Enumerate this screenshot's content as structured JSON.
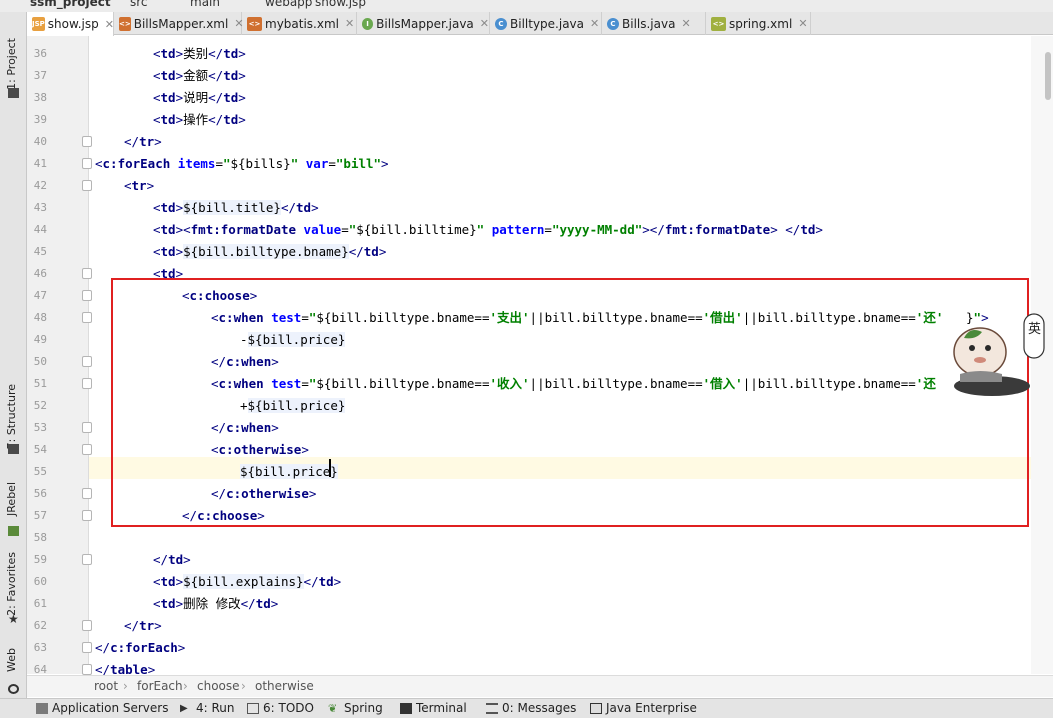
{
  "breadcrumb_top": [
    "ssm_project",
    "src",
    "main",
    "webapp",
    "show.jsp"
  ],
  "tabs": [
    {
      "label": "show.jsp",
      "icon": "jsp-file-icon",
      "active": true
    },
    {
      "label": "BillsMapper.xml",
      "icon": "xml-file-icon",
      "active": false
    },
    {
      "label": "mybatis.xml",
      "icon": "xml-file-icon",
      "active": false
    },
    {
      "label": "BillsMapper.java",
      "icon": "java-interface-icon",
      "active": false
    },
    {
      "label": "Billtype.java",
      "icon": "java-class-icon",
      "active": false
    },
    {
      "label": "Bills.java",
      "icon": "java-class-icon",
      "active": false
    },
    {
      "label": "spring.xml",
      "icon": "spring-xml-icon",
      "active": false
    }
  ],
  "left_tools": [
    "1: Project",
    "7: Structure",
    "JRebel",
    "2: Favorites",
    "Web"
  ],
  "line_numbers": [
    "36",
    "37",
    "38",
    "39",
    "40",
    "41",
    "42",
    "43",
    "44",
    "45",
    "46",
    "47",
    "48",
    "49",
    "50",
    "51",
    "52",
    "53",
    "54",
    "55",
    "56",
    "57",
    "58",
    "59",
    "60",
    "61",
    "62",
    "63",
    "64"
  ],
  "path_bar": [
    "root",
    "forEach",
    "choose",
    "otherwise"
  ],
  "bottom_tools": [
    "Application Servers",
    "4: Run",
    "6: TODO",
    "Spring",
    "Terminal",
    "0: Messages",
    "Java Enterprise"
  ],
  "sticker_text": "英",
  "colors": {
    "highlight_box": "#e02020",
    "tag": "#000080",
    "attr_name": "#0000ff",
    "attr_value": "#008000",
    "current_line": "#fffae3"
  }
}
